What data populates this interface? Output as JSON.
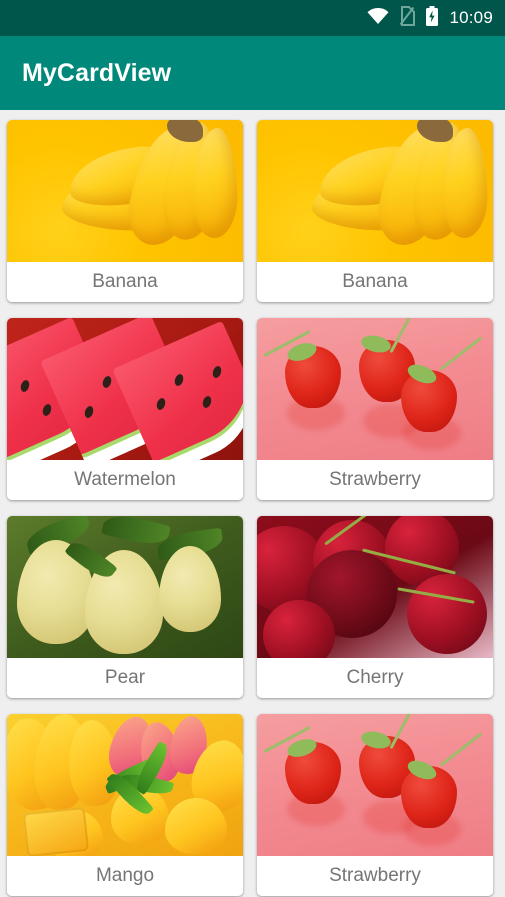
{
  "status_bar": {
    "icons": [
      "wifi-icon",
      "no-sim-icon",
      "battery-charging-icon"
    ],
    "time": "10:09",
    "background_color": "#00564B"
  },
  "app_bar": {
    "title": "MyCardView",
    "background_color": "#00897B",
    "title_color": "#FFFFFF"
  },
  "grid": {
    "background_color": "#EFEFEF",
    "card_background_color": "#FFFFFF",
    "label_color": "#757575",
    "columns": 2,
    "cards": [
      {
        "label": "Banana",
        "image": "banana-photo"
      },
      {
        "label": "Banana",
        "image": "banana-photo"
      },
      {
        "label": "Watermelon",
        "image": "watermelon-photo"
      },
      {
        "label": "Strawberry",
        "image": "strawberry-photo"
      },
      {
        "label": "Pear",
        "image": "pear-photo"
      },
      {
        "label": "Cherry",
        "image": "cherry-photo"
      },
      {
        "label": "Mango",
        "image": "mango-photo"
      },
      {
        "label": "Strawberry",
        "image": "strawberry-photo"
      }
    ]
  }
}
